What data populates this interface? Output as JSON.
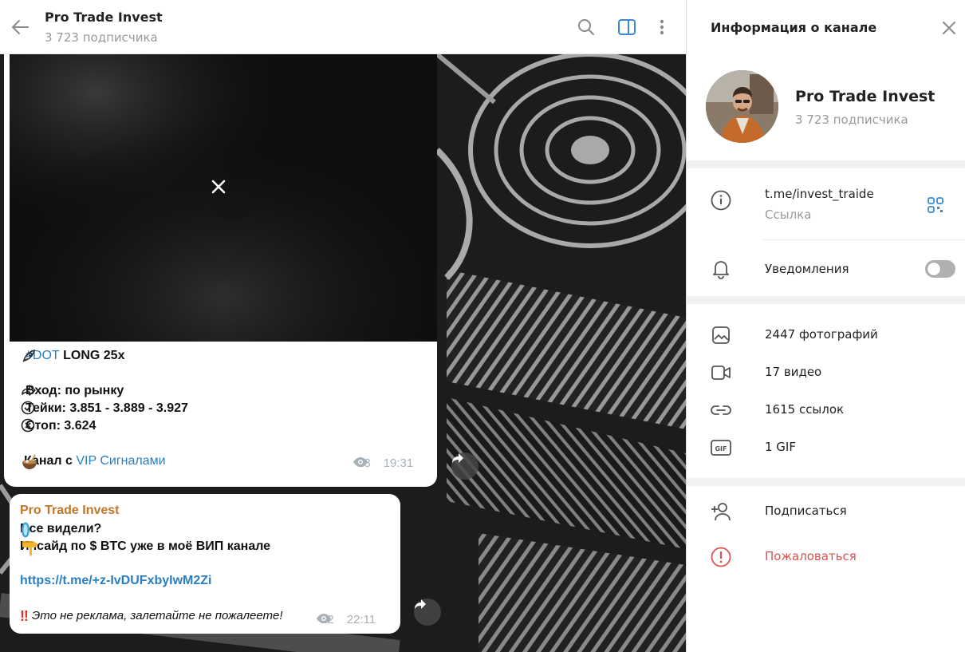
{
  "chat": {
    "title": "Pro Trade Invest",
    "subscribers": "3 723 подписчика"
  },
  "messages": [
    {
      "hashtag": "#DOT",
      "heading_rest": " LONG 25x",
      "entry": "Вход: по рынку",
      "takes": "Тейки: 3.851 - 3.889 - 3.927",
      "stop": "Стоп: 3.624",
      "channel_prefix": "Канал с ",
      "channel_link": "VIP Сигналами",
      "views": "13",
      "time": "19:31"
    },
    {
      "sender": "Pro Trade Invest",
      "line1": "Все видели? ",
      "line2": "Инсайд по $ BTC уже в моё ВИП канале",
      "url": "https://t.me/+z-IvDUFxbyIwM2Zi",
      "footer_note": "Это не реклама, залетайте не пожалеете!",
      "views": "12",
      "time": "22:11"
    }
  ],
  "panel": {
    "title": "Информация о канале",
    "name": "Pro Trade Invest",
    "subscribers": "3 723 подписчика",
    "link": "t.me/invest_traide",
    "link_caption": "Ссылка",
    "notifications": "Уведомления",
    "notifications_on": false,
    "media": [
      {
        "icon": "photo-icon",
        "label": "2447 фотографий"
      },
      {
        "icon": "video-icon",
        "label": "17 видео"
      },
      {
        "icon": "link-icon",
        "label": "1615 ссылок"
      },
      {
        "icon": "gif-icon",
        "label": "1 GIF"
      }
    ],
    "subscribe": "Подписаться",
    "report": "Пожаловаться"
  },
  "colors": {
    "link": "#2a7fc1",
    "sender": "#c0762b",
    "report": "#d9534f",
    "muted": "#999999"
  }
}
